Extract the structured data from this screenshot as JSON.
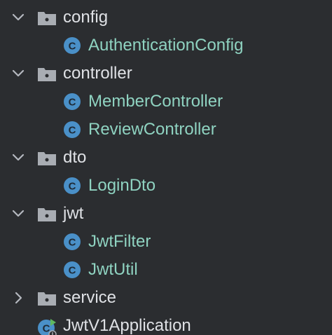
{
  "tree": {
    "config": {
      "label": "config",
      "expanded": true,
      "children": [
        "AuthenticationConfig"
      ]
    },
    "controller": {
      "label": "controller",
      "expanded": true,
      "children": [
        "MemberController",
        "ReviewController"
      ]
    },
    "dto": {
      "label": "dto",
      "expanded": true,
      "children": [
        "LoginDto"
      ]
    },
    "jwt": {
      "label": "jwt",
      "expanded": true,
      "children": [
        "JwtFilter",
        "JwtUtil"
      ]
    },
    "service": {
      "label": "service",
      "expanded": false
    },
    "app": {
      "label": "JwtV1Application"
    }
  },
  "colors": {
    "background": "#2b2d30",
    "folder_text": "#dfe1e5",
    "class_text": "#8fd3c1",
    "class_icon": "#4a90c8",
    "folder_icon": "#a9adb3",
    "chevron": "#b4b8bf",
    "run_badge": "#5fb85f"
  },
  "icons": {
    "expanded": "chevron-down-icon",
    "collapsed": "chevron-right-icon",
    "package": "package-folder-icon",
    "class": "java-class-icon",
    "application": "spring-boot-application-icon"
  }
}
